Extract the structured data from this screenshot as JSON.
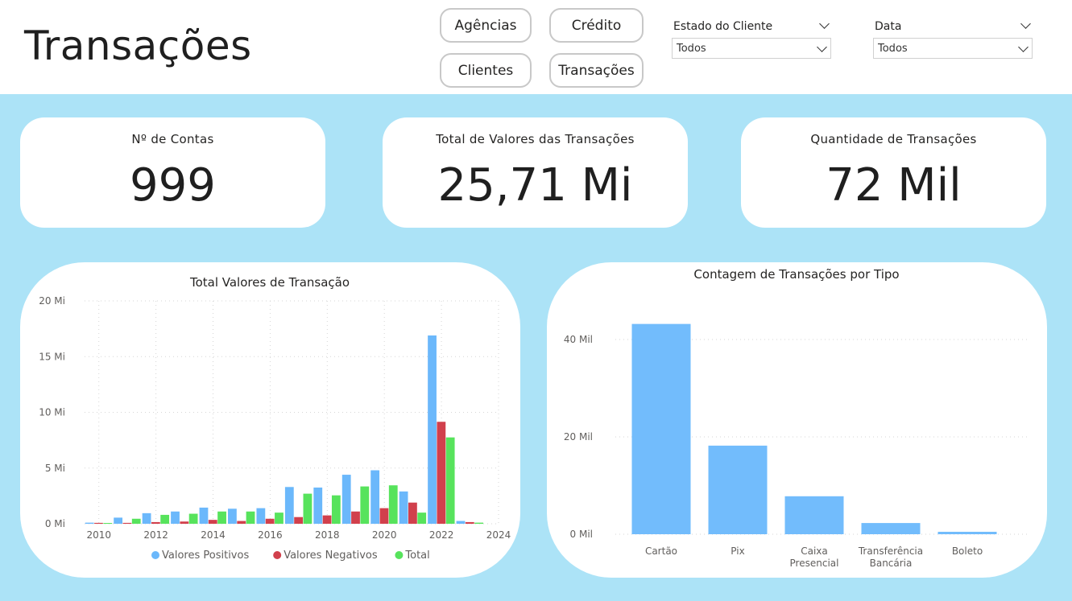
{
  "header": {
    "title": "Transações",
    "nav": [
      "Agências",
      "Crédito",
      "Clientes",
      "Transações"
    ],
    "slicers": [
      {
        "label": "Estado do Cliente",
        "value": "Todos"
      },
      {
        "label": "Data",
        "value": "Todos"
      }
    ]
  },
  "cards": [
    {
      "label": "Nº de Contas",
      "value": "999"
    },
    {
      "label": "Total de Valores das Transações",
      "value": "25,71 Mi"
    },
    {
      "label": "Quantidade de Transações",
      "value": "72 Mil"
    }
  ],
  "colors": {
    "positive": "#6bb8fb",
    "negative": "#d1404c",
    "total": "#57e35c",
    "bar": "#72bcfc",
    "canvas": "#ace3f7"
  },
  "chart_data": [
    {
      "type": "bar",
      "title": "Total Valores de Transação",
      "x": [
        2010,
        2011,
        2012,
        2013,
        2014,
        2015,
        2016,
        2017,
        2018,
        2019,
        2020,
        2021,
        2022,
        2023
      ],
      "x_ticks": [
        "2010",
        "2012",
        "2014",
        "2016",
        "2018",
        "2020",
        "2022",
        "2024"
      ],
      "y_ticks": [
        "0 Mi",
        "5 Mi",
        "10 Mi",
        "15 Mi",
        "20 Mi"
      ],
      "xlim": [
        2009.5,
        2024
      ],
      "ylim": [
        0,
        20
      ],
      "series": [
        {
          "name": "Valores Positivos",
          "values": [
            0.1,
            0.55,
            0.95,
            1.1,
            1.45,
            1.35,
            1.4,
            3.3,
            3.25,
            4.4,
            4.8,
            2.9,
            16.9,
            0.25
          ]
        },
        {
          "name": "Valores Negativos",
          "values": [
            0.08,
            0.08,
            0.15,
            0.2,
            0.35,
            0.25,
            0.45,
            0.6,
            0.75,
            1.1,
            1.4,
            1.9,
            9.15,
            0.15
          ]
        },
        {
          "name": "Total",
          "values": [
            0.07,
            0.45,
            0.8,
            0.9,
            1.1,
            1.1,
            1.0,
            2.7,
            2.55,
            3.35,
            3.45,
            1.0,
            7.75,
            0.1
          ]
        }
      ],
      "legend": "bottom",
      "grid": true
    },
    {
      "type": "bar",
      "title": "Contagem de Transações por Tipo",
      "categories": [
        "Cartão",
        "Pix",
        "Caixa Presencial",
        "Transferência Bancária",
        "Boleto"
      ],
      "category_lines": [
        [
          "Cartão"
        ],
        [
          "Pix"
        ],
        [
          "Caixa",
          "Presencial"
        ],
        [
          "Transferência",
          "Bancária"
        ],
        [
          "Boleto"
        ]
      ],
      "values": [
        43.2,
        18.2,
        7.8,
        2.3,
        0.5
      ],
      "y_ticks": [
        "0 Mil",
        "20 Mil",
        "40 Mil"
      ],
      "ylim": [
        0,
        40
      ],
      "grid": true
    }
  ]
}
